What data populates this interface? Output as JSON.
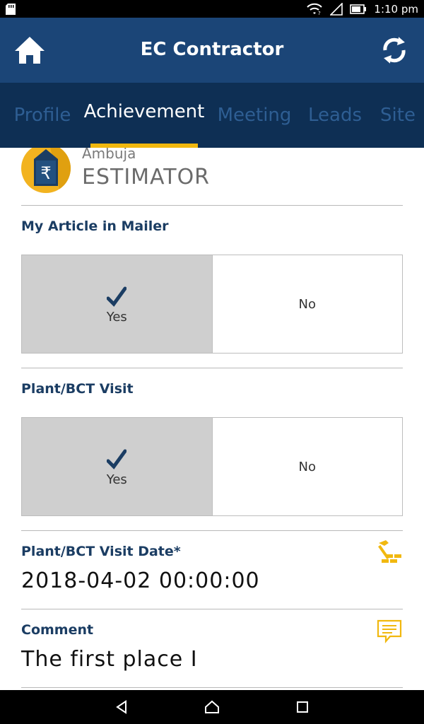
{
  "status_bar": {
    "time": "1:10 pm",
    "icons": [
      "sd-card-icon",
      "wifi-icon",
      "signal-icon",
      "battery-icon"
    ]
  },
  "app_bar": {
    "title": "EC Contractor",
    "left_icon": "home-icon",
    "right_icon": "refresh-icon",
    "background": "#1b4577"
  },
  "tabs": [
    {
      "label": "Profile",
      "active": false
    },
    {
      "label": "Achievement",
      "active": true
    },
    {
      "label": "Meeting",
      "active": false
    },
    {
      "label": "Leads",
      "active": false
    },
    {
      "label": "Site",
      "active": false
    }
  ],
  "profile": {
    "brand": "Ambuja",
    "title": "ESTIMATOR",
    "logo_icon": "rupee-house-logo"
  },
  "sections": {
    "article": {
      "label": "My Article in Mailer",
      "options": [
        "Yes",
        "No"
      ],
      "selected": "Yes"
    },
    "plant_visit": {
      "label": "Plant/BCT Visit",
      "options": [
        "Yes",
        "No"
      ],
      "selected": "Yes"
    },
    "visit_date": {
      "label": "Plant/BCT Visit Date*",
      "value": "2018-04-02 00:00:00",
      "icon": "construction-icon"
    },
    "comment": {
      "label": "Comment",
      "value": "The first place I",
      "icon": "comment-icon"
    }
  },
  "colors": {
    "accent": "#f1b80f",
    "tab_bg": "#0e2f54",
    "label": "#1b3d63",
    "selected_bg": "#cfcfcf"
  },
  "nav_bar": {
    "icons": [
      "back-icon",
      "home-nav-icon",
      "recents-icon"
    ]
  }
}
